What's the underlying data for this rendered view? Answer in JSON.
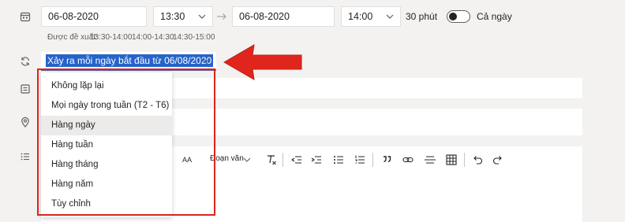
{
  "start": {
    "date": "06-08-2020",
    "time": "13:30"
  },
  "end": {
    "date": "06-08-2020",
    "time": "14:00"
  },
  "duration": "30 phút",
  "all_day": {
    "label": "Cả ngày",
    "enabled": false
  },
  "suggestions": {
    "label": "Được đề xuất:",
    "slots": [
      "13:30-14:00",
      "14:00-14:30",
      "14:30-15:00"
    ]
  },
  "repeat": {
    "selected": "Xảy ra mỗi ngày bắt đầu từ 06/08/2020",
    "options": [
      "Không lặp lại",
      "Mọi ngày trong tuần (T2 - T6)",
      "Hàng ngày",
      "Hàng tuần",
      "Hàng tháng",
      "Hàng năm",
      "Tùy chỉnh"
    ],
    "highlighted": "Hàng ngày"
  },
  "toolbar": {
    "font_size_label": "AA",
    "paragraph_label": "Đoạn văn"
  },
  "icons": [
    "calendar-icon",
    "repeat-icon",
    "room-icon",
    "location-icon",
    "details-icon"
  ],
  "colors": {
    "accent": "#6264a7",
    "annotation": "#d9261c",
    "selection": "#2563c9"
  }
}
